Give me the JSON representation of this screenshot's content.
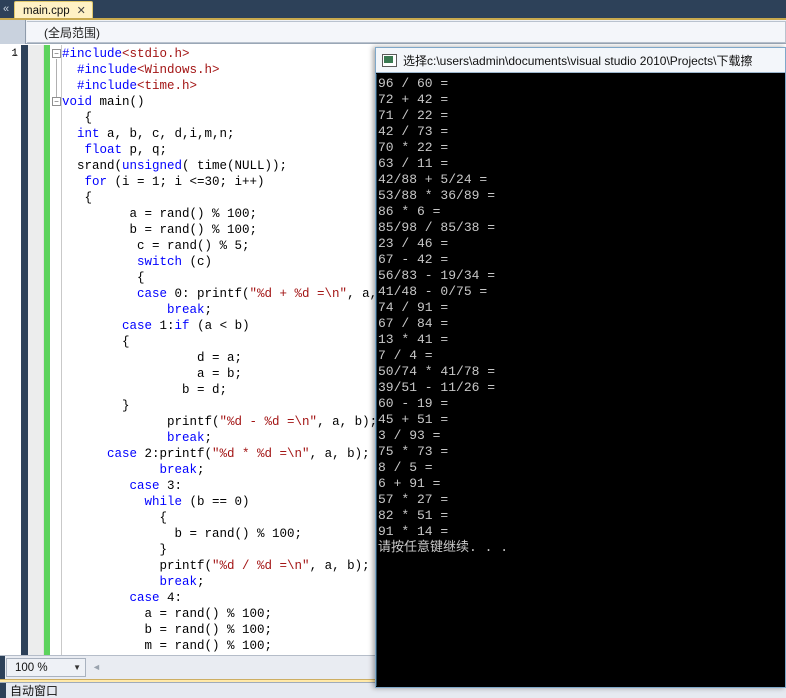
{
  "window": {
    "ide_name": "Visual Studio 2010"
  },
  "tabbar": {
    "chevron": "«",
    "active_tab": "main.cpp",
    "close_glyph": "✕"
  },
  "scopebar": {
    "value": "(全局范围)"
  },
  "gutter": {
    "first_line_number": "1",
    "dots_glyph": "··"
  },
  "editor": {
    "fold_glyph": "−",
    "lines": [
      [
        {
          "t": "#include",
          "c": "pp"
        },
        {
          "t": "<stdio.h>",
          "c": "inc"
        }
      ],
      [
        {
          "t": "  #include",
          "c": "pp"
        },
        {
          "t": "<Windows.h>",
          "c": "inc"
        }
      ],
      [
        {
          "t": "  #include",
          "c": "pp"
        },
        {
          "t": "<time.h>",
          "c": "inc"
        }
      ],
      [
        {
          "t": "void",
          "c": "k"
        },
        {
          "t": " main()",
          "c": "pl"
        }
      ],
      [
        {
          "t": "   {",
          "c": "pl"
        }
      ],
      [
        {
          "t": "  ",
          "c": "pl"
        },
        {
          "t": "int",
          "c": "k"
        },
        {
          "t": " a, b, c, d,i,m,n;",
          "c": "pl"
        }
      ],
      [
        {
          "t": "   ",
          "c": "pl"
        },
        {
          "t": "float",
          "c": "k"
        },
        {
          "t": " p, q;",
          "c": "pl"
        }
      ],
      [
        {
          "t": "  srand(",
          "c": "pl"
        },
        {
          "t": "unsigned",
          "c": "k"
        },
        {
          "t": "( time(NULL));",
          "c": "pl"
        }
      ],
      [
        {
          "t": "   ",
          "c": "pl"
        },
        {
          "t": "for",
          "c": "k"
        },
        {
          "t": " (i = 1; i <=30; i++)",
          "c": "pl"
        }
      ],
      [
        {
          "t": "   {",
          "c": "pl"
        }
      ],
      [
        {
          "t": "         a = rand() % 100;",
          "c": "pl"
        }
      ],
      [
        {
          "t": "         b = rand() % 100;",
          "c": "pl"
        }
      ],
      [
        {
          "t": "          c = rand() % 5;",
          "c": "pl"
        }
      ],
      [
        {
          "t": "          ",
          "c": "pl"
        },
        {
          "t": "switch",
          "c": "k"
        },
        {
          "t": " (c)",
          "c": "pl"
        }
      ],
      [
        {
          "t": "          {",
          "c": "pl"
        }
      ],
      [
        {
          "t": "          ",
          "c": "pl"
        },
        {
          "t": "case",
          "c": "k"
        },
        {
          "t": " 0: printf(",
          "c": "pl"
        },
        {
          "t": "\"%d + %d =\\n\"",
          "c": "str"
        },
        {
          "t": ", a, b);",
          "c": "pl"
        }
      ],
      [
        {
          "t": "              ",
          "c": "pl"
        },
        {
          "t": "break",
          "c": "k"
        },
        {
          "t": ";",
          "c": "pl"
        }
      ],
      [
        {
          "t": "        ",
          "c": "pl"
        },
        {
          "t": "case",
          "c": "k"
        },
        {
          "t": " 1:",
          "c": "pl"
        },
        {
          "t": "if",
          "c": "k"
        },
        {
          "t": " (a < b)",
          "c": "pl"
        }
      ],
      [
        {
          "t": "        {",
          "c": "pl"
        }
      ],
      [
        {
          "t": "                  d = a;",
          "c": "pl"
        }
      ],
      [
        {
          "t": "                  a = b;",
          "c": "pl"
        }
      ],
      [
        {
          "t": "                b = d;",
          "c": "pl"
        }
      ],
      [
        {
          "t": "        }",
          "c": "pl"
        }
      ],
      [
        {
          "t": "              printf(",
          "c": "pl"
        },
        {
          "t": "\"%d - %d =\\n\"",
          "c": "str"
        },
        {
          "t": ", a, b);",
          "c": "pl"
        }
      ],
      [
        {
          "t": "              ",
          "c": "pl"
        },
        {
          "t": "break",
          "c": "k"
        },
        {
          "t": ";",
          "c": "pl"
        }
      ],
      [
        {
          "t": "      ",
          "c": "pl"
        },
        {
          "t": "case",
          "c": "k"
        },
        {
          "t": " 2:printf(",
          "c": "pl"
        },
        {
          "t": "\"%d * %d =\\n\"",
          "c": "str"
        },
        {
          "t": ", a, b);",
          "c": "pl"
        }
      ],
      [
        {
          "t": "             ",
          "c": "pl"
        },
        {
          "t": "break",
          "c": "k"
        },
        {
          "t": ";",
          "c": "pl"
        }
      ],
      [
        {
          "t": "         ",
          "c": "pl"
        },
        {
          "t": "case",
          "c": "k"
        },
        {
          "t": " 3:",
          "c": "pl"
        }
      ],
      [
        {
          "t": "           ",
          "c": "pl"
        },
        {
          "t": "while",
          "c": "k"
        },
        {
          "t": " (b == 0)",
          "c": "pl"
        }
      ],
      [
        {
          "t": "             {",
          "c": "pl"
        }
      ],
      [
        {
          "t": "               b = rand() % 100;",
          "c": "pl"
        }
      ],
      [
        {
          "t": "             }",
          "c": "pl"
        }
      ],
      [
        {
          "t": "             printf(",
          "c": "pl"
        },
        {
          "t": "\"%d / %d =\\n\"",
          "c": "str"
        },
        {
          "t": ", a, b);",
          "c": "pl"
        }
      ],
      [
        {
          "t": "             ",
          "c": "pl"
        },
        {
          "t": "break",
          "c": "k"
        },
        {
          "t": ";",
          "c": "pl"
        }
      ],
      [
        {
          "t": "         ",
          "c": "pl"
        },
        {
          "t": "case",
          "c": "k"
        },
        {
          "t": " 4:",
          "c": "pl"
        }
      ],
      [
        {
          "t": "           a = rand() % 100;",
          "c": "pl"
        }
      ],
      [
        {
          "t": "           b = rand() % 100;",
          "c": "pl"
        }
      ],
      [
        {
          "t": "           m = rand() % 100;",
          "c": "pl"
        }
      ]
    ]
  },
  "zoombar": {
    "zoom_level": "100 %",
    "caret": "▼",
    "scroll_arrow": "◄"
  },
  "bottom_panel": {
    "tab_label": "自动窗口"
  },
  "console": {
    "title": "选择c:\\users\\admin\\documents\\visual studio 2010\\Projects\\下载擦",
    "lines": [
      "96 / 60 =",
      "72 + 42 =",
      "71 / 22 =",
      "42 / 73 =",
      "70 * 22 =",
      "63 / 11 =",
      "42/88 + 5/24 =",
      "53/88 * 36/89 =",
      "86 * 6 =",
      "85/98 / 85/38 =",
      "23 / 46 =",
      "67 - 42 =",
      "56/83 - 19/34 =",
      "41/48 - 0/75 =",
      "74 / 91 =",
      "67 / 84 =",
      "13 * 41 =",
      "7 / 4 =",
      "50/74 * 41/78 =",
      "39/51 - 11/26 =",
      "60 - 19 =",
      "45 + 51 =",
      "3 / 93 =",
      "75 * 73 =",
      "8 / 5 =",
      "6 + 91 =",
      "57 * 27 =",
      "82 * 51 =",
      "91 * 14 =",
      "请按任意键继续. . ."
    ]
  },
  "colors": {
    "chrome_navy": "#2d4159",
    "tab_active": "#fff1c4",
    "change_bar_green": "#5dd35d",
    "keyword_blue": "#0000ff",
    "string_red": "#a31515",
    "console_bg": "#000000",
    "console_fg": "#c8c8c8"
  }
}
